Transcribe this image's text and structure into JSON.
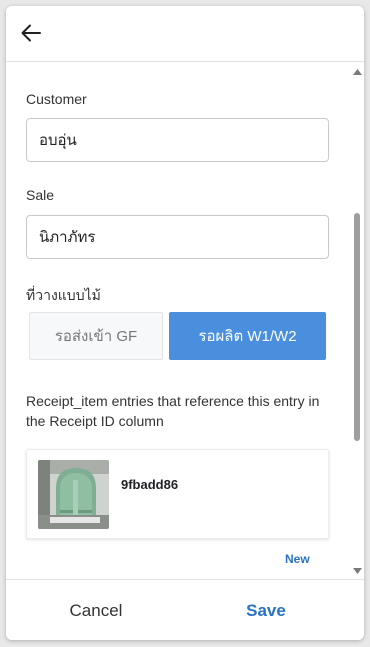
{
  "header": {
    "back_icon": "arrow-left-icon"
  },
  "form": {
    "customer": {
      "label": "Customer",
      "value": "อบอุ่น"
    },
    "sale": {
      "label": "Sale",
      "value": "นิภาภัทร"
    },
    "location": {
      "label": "ที่วางแบบไม้",
      "options": [
        "รอส่งเข้า GF",
        "รอผลิต W1/W2"
      ],
      "selected": "รอผลิต W1/W2"
    }
  },
  "related": {
    "label": "Receipt_item entries that reference this entry in the Receipt ID column",
    "items": [
      {
        "id": "9fbadd86"
      }
    ],
    "new_label": "New"
  },
  "footer": {
    "cancel_label": "Cancel",
    "save_label": "Save"
  },
  "colors": {
    "accent": "#2a73c2",
    "selected_segment": "#4a8fde"
  }
}
